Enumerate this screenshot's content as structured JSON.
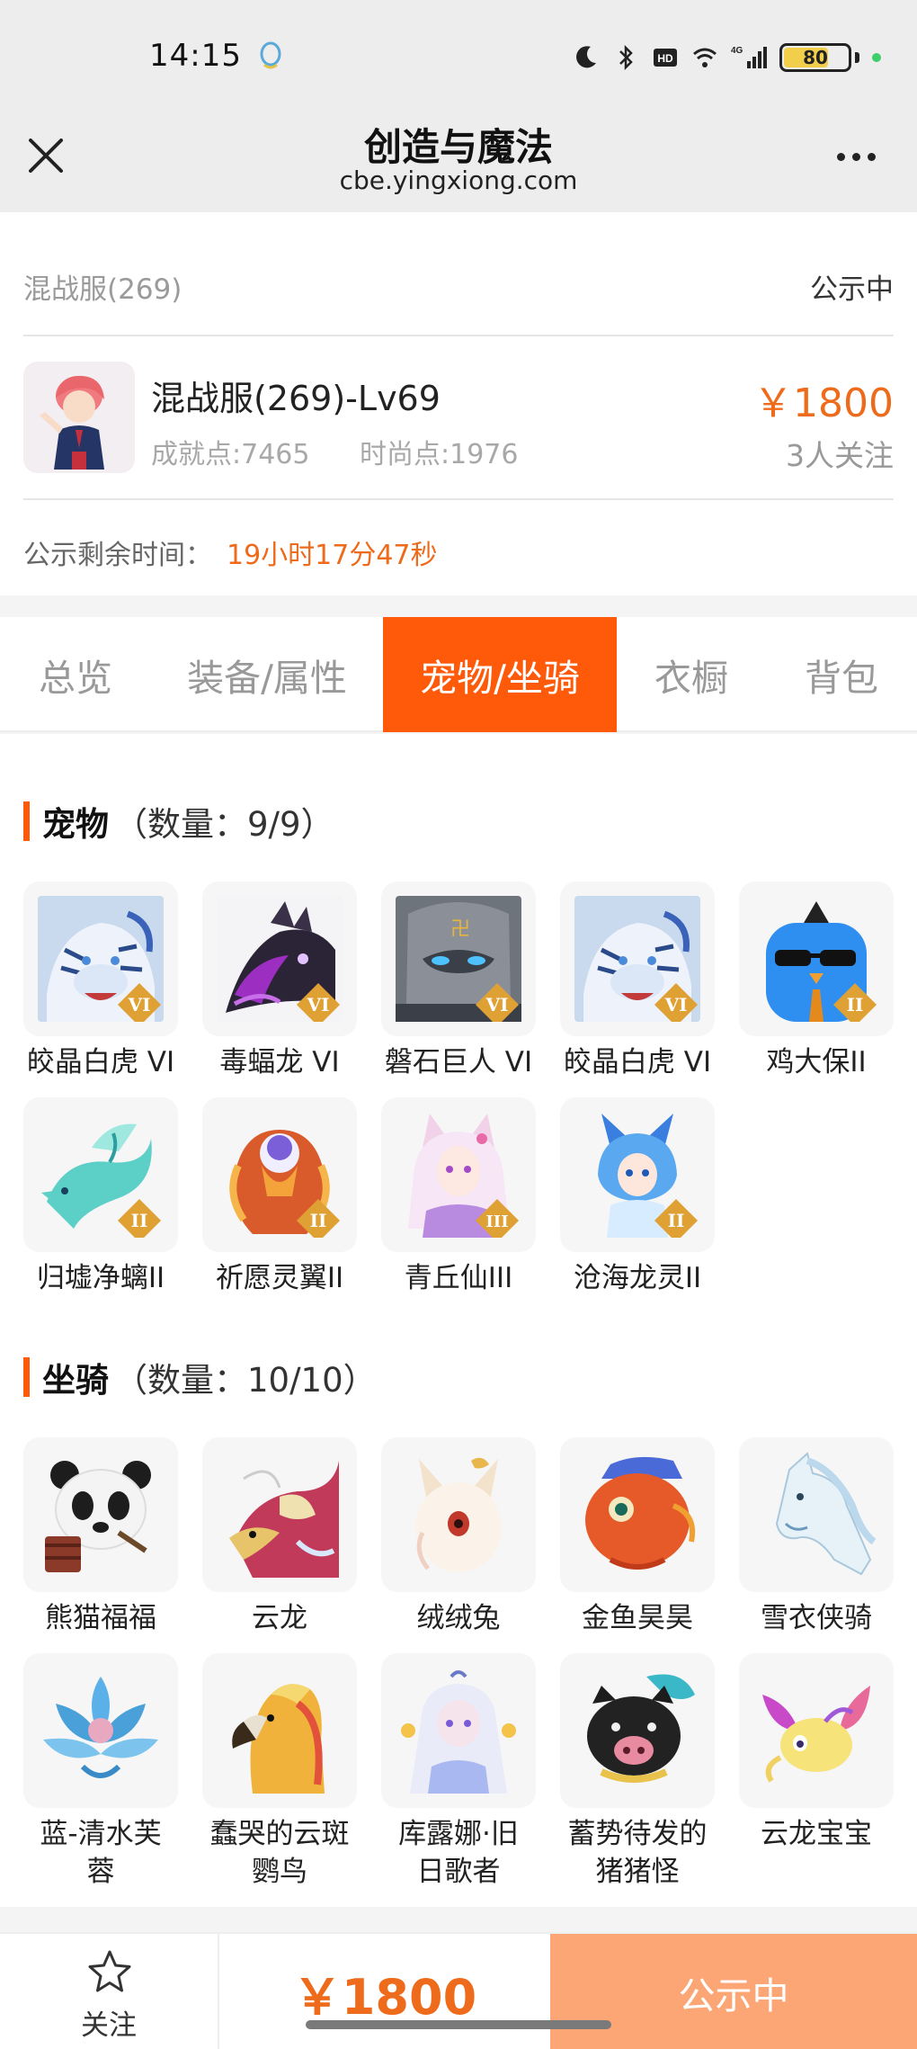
{
  "status_bar": {
    "time": "14:15",
    "battery": "80",
    "network": "4G"
  },
  "header": {
    "title": "创造与魔法",
    "url": "cbe.yingxiong.com"
  },
  "info": {
    "server": "混战服(269)",
    "status": "公示中",
    "char_name": "混战服(269)-Lv69",
    "achievement": "成就点:7465",
    "fashion": "时尚点:1976",
    "price": "￥1800",
    "followers": "3人关注",
    "remain_label": "公示剩余时间：",
    "remain_value": "19小时17分47秒"
  },
  "tabs": [
    {
      "label": "总览"
    },
    {
      "label": "装备/属性"
    },
    {
      "label": "宠物/坐骑"
    },
    {
      "label": "衣橱"
    },
    {
      "label": "背包"
    }
  ],
  "pets": {
    "title": "宠物",
    "count": "（数量：9/9）",
    "items": [
      {
        "label": "皎晶白虎 VI",
        "badge": "VI"
      },
      {
        "label": "毒蝠龙 VI",
        "badge": "VI"
      },
      {
        "label": "磐石巨人 VI",
        "badge": "VI"
      },
      {
        "label": "皎晶白虎 VI",
        "badge": "VI"
      },
      {
        "label": "鸡大保II",
        "badge": "II"
      },
      {
        "label": "归墟净螭II",
        "badge": "II"
      },
      {
        "label": "祈愿灵翼II",
        "badge": "II"
      },
      {
        "label": "青丘仙III",
        "badge": "III"
      },
      {
        "label": "沧海龙灵II",
        "badge": "II"
      }
    ]
  },
  "mounts": {
    "title": "坐骑",
    "count": "（数量：10/10）",
    "items": [
      {
        "label": "熊猫福福",
        "label2": ""
      },
      {
        "label": "云龙",
        "label2": ""
      },
      {
        "label": "绒绒兔",
        "label2": ""
      },
      {
        "label": "金鱼昊昊",
        "label2": ""
      },
      {
        "label": "雪衣侠骑",
        "label2": ""
      },
      {
        "label": "蓝-清水芙",
        "label2": "蓉"
      },
      {
        "label": "蠢哭的云斑",
        "label2": "鹦鸟"
      },
      {
        "label": "库露娜·旧",
        "label2": "日歌者"
      },
      {
        "label": "蓄势待发的",
        "label2": "猪猪怪"
      },
      {
        "label": "云龙宝宝",
        "label2": ""
      }
    ]
  },
  "bottom": {
    "follow_label": "关注",
    "price": "￥1800",
    "action": "公示中"
  }
}
